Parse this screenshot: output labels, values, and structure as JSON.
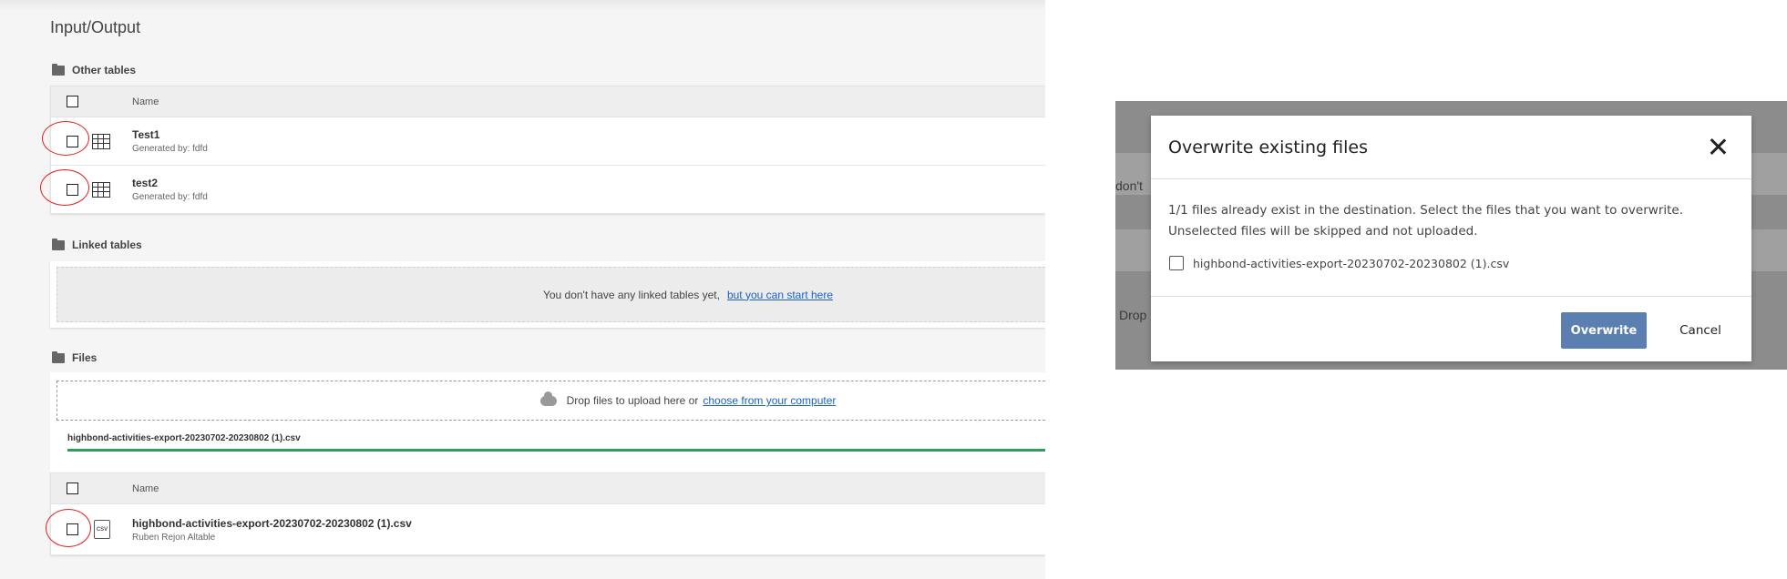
{
  "page": {
    "title": "Input/Output"
  },
  "other_tables": {
    "heading": "Other tables",
    "column_name": "Name",
    "rows": [
      {
        "title": "Test1",
        "subtitle": "Generated by: fdfd"
      },
      {
        "title": "test2",
        "subtitle": "Generated by: fdfd"
      }
    ]
  },
  "linked_tables": {
    "heading": "Linked tables",
    "empty_text": "You don't have any linked tables yet,",
    "empty_link": "but you can start here"
  },
  "files": {
    "heading": "Files",
    "drop_text": "Drop files to upload here or",
    "drop_link": "choose from your computer",
    "upload_name": "highbond-activities-export-20230702-20230802 (1).csv",
    "upload_progress_percent": 100,
    "column_name": "Name",
    "rows": [
      {
        "title": "highbond-activities-export-20230702-20230802 (1).csv",
        "subtitle": "Ruben Rejon Altable",
        "icon_text": "CSV"
      }
    ]
  },
  "background_behind_modal": {
    "text1": "don't",
    "text2": "Drop"
  },
  "dialog": {
    "title": "Overwrite existing files",
    "message": "1/1 files already exist in the destination. Select the files that you want to overwrite. Unselected files will be skipped and not uploaded.",
    "file_option": "highbond-activities-export-20230702-20230802 (1).csv",
    "overwrite_label": "Overwrite",
    "cancel_label": "Cancel"
  },
  "colors": {
    "primary_button": "#5a7fb0",
    "link": "#1a62c0",
    "progress": "#2e9e5e",
    "annotation_circle": "#e02020"
  },
  "icons": [
    "folder-icon",
    "table-icon",
    "csv-file-icon",
    "cloud-upload-icon",
    "close-icon"
  ]
}
